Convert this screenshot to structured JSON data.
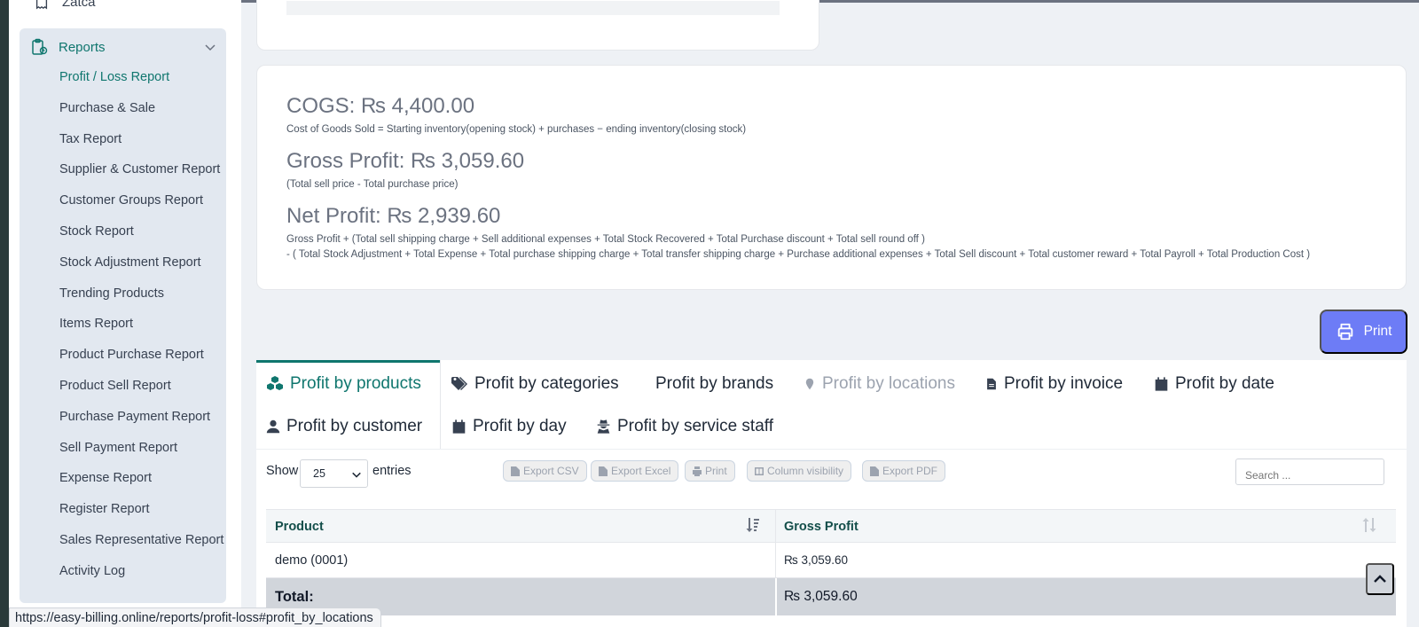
{
  "sidebar": {
    "prev_item": "Zatca",
    "reports_label": "Reports",
    "items": [
      {
        "label": "Profit / Loss Report",
        "active": true
      },
      {
        "label": "Purchase & Sale"
      },
      {
        "label": "Tax Report"
      },
      {
        "label": "Supplier & Customer Report"
      },
      {
        "label": "Customer Groups Report"
      },
      {
        "label": "Stock Report"
      },
      {
        "label": "Stock Adjustment Report"
      },
      {
        "label": "Trending Products"
      },
      {
        "label": "Items Report"
      },
      {
        "label": "Product Purchase Report"
      },
      {
        "label": "Product Sell Report"
      },
      {
        "label": "Purchase Payment Report"
      },
      {
        "label": "Sell Payment Report"
      },
      {
        "label": "Expense Report"
      },
      {
        "label": "Register Report"
      },
      {
        "label": "Sales Representative Report"
      },
      {
        "label": "Activity Log"
      }
    ]
  },
  "summary": {
    "cogs": "COGS: ₨ 4,400.00",
    "cogs_note": "Cost of Goods Sold = Starting inventory(opening stock) + purchases − ending inventory(closing stock)",
    "gross": "Gross Profit: ₨ 3,059.60",
    "gross_note": "(Total sell price - Total purchase price)",
    "net": "Net Profit: ₨ 2,939.60",
    "net_note_1": "Gross Profit + (Total sell shipping charge + Sell additional expenses + Total Stock Recovered + Total Purchase discount + Total sell round off )",
    "net_note_2": "- ( Total Stock Adjustment + Total Expense + Total purchase shipping charge + Total transfer shipping charge + Purchase additional expenses + Total Sell discount + Total customer reward + Total Payroll + Total Production Cost )"
  },
  "print_label": "Print",
  "tabs": {
    "products": "Profit by products",
    "categories": "Profit by categories",
    "brands": "Profit by brands",
    "locations": "Profit by locations",
    "invoice": "Profit by invoice",
    "date": "Profit by date",
    "customer": "Profit by customer",
    "day": "Profit by day",
    "service_staff": "Profit by service staff"
  },
  "table_controls": {
    "show": "Show",
    "page_size": "25",
    "entries": "entries",
    "export_csv": "Export CSV",
    "export_excel": "Export Excel",
    "print": "Print",
    "column_visibility": "Column visibility",
    "export_pdf": "Export PDF",
    "search_placeholder": "Search ..."
  },
  "table": {
    "headers": [
      "Product",
      "Gross Profit"
    ],
    "rows": [
      [
        "demo (0001)",
        "₨ 3,059.60"
      ]
    ],
    "total_label": "Total:",
    "total_value": "₨ 3,059.60"
  },
  "status_url": "https://easy-billing.online/reports/profit-loss#profit_by_locations",
  "colors": {
    "accent": "#0f766e",
    "print_button": "#6d7cf6",
    "sidebar_group_bg": "#e2e8f0",
    "total_row_bg": "#d1d5db"
  }
}
